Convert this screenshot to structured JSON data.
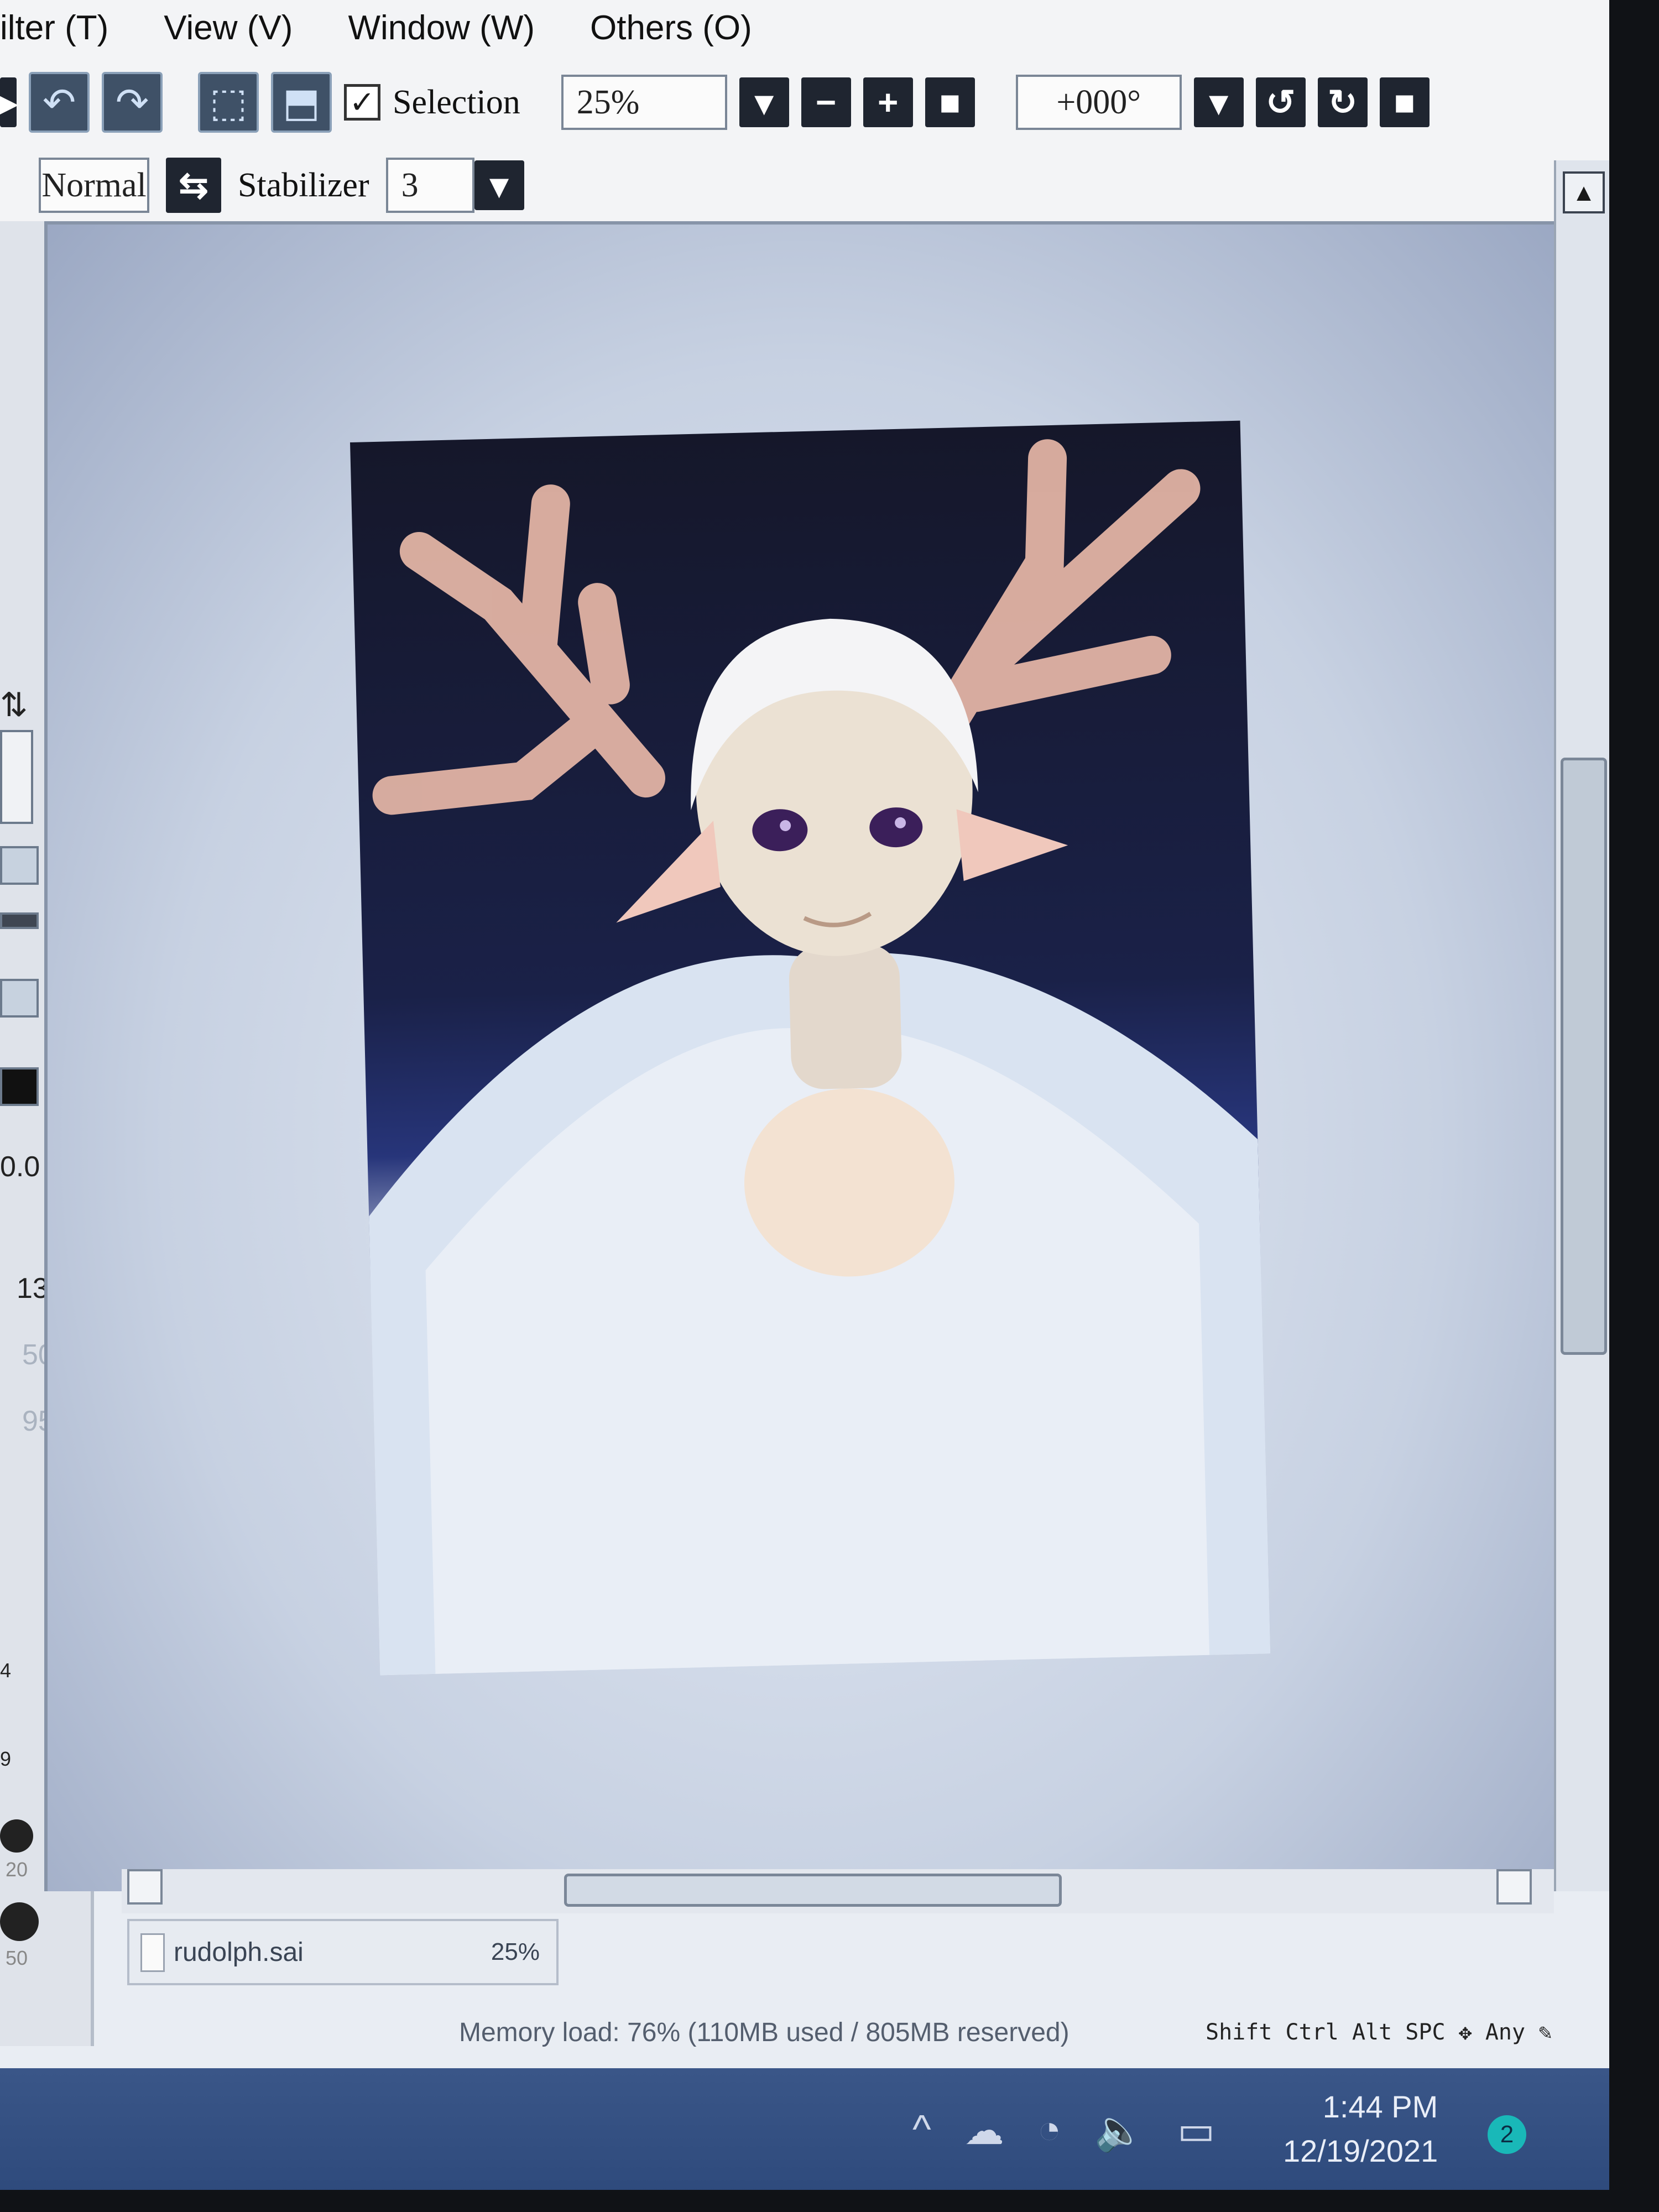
{
  "menu": {
    "items": [
      "ilter (T)",
      "View (V)",
      "Window (W)",
      "Others (O)"
    ]
  },
  "toolbar": {
    "selection_label": "Selection",
    "zoom_value": "25%",
    "rotation_value": "+000°",
    "blend_mode": "Normal",
    "stabilizer_label": "Stabilizer",
    "stabilizer_value": "3"
  },
  "left_panel": {
    "value_opacity": "0.0",
    "value_size": "13",
    "value_a": "50",
    "value_b": "95",
    "brush_sizes": [
      "4",
      "9",
      "20",
      "50"
    ]
  },
  "document": {
    "file_name": "rudolph.sai",
    "file_zoom": "25%"
  },
  "status": {
    "memory": "Memory load: 76% (110MB used / 805MB reserved)",
    "modifiers": [
      "Shift",
      "Ctrl",
      "Alt",
      "SPC"
    ],
    "any_label": "Any"
  },
  "taskbar": {
    "time": "1:44 PM",
    "date": "12/19/2021",
    "notification_count": "2"
  },
  "colors": {
    "button_dark": "#1f2530",
    "taskbar": "#2e4a7c",
    "badge": "#19b8b8"
  }
}
